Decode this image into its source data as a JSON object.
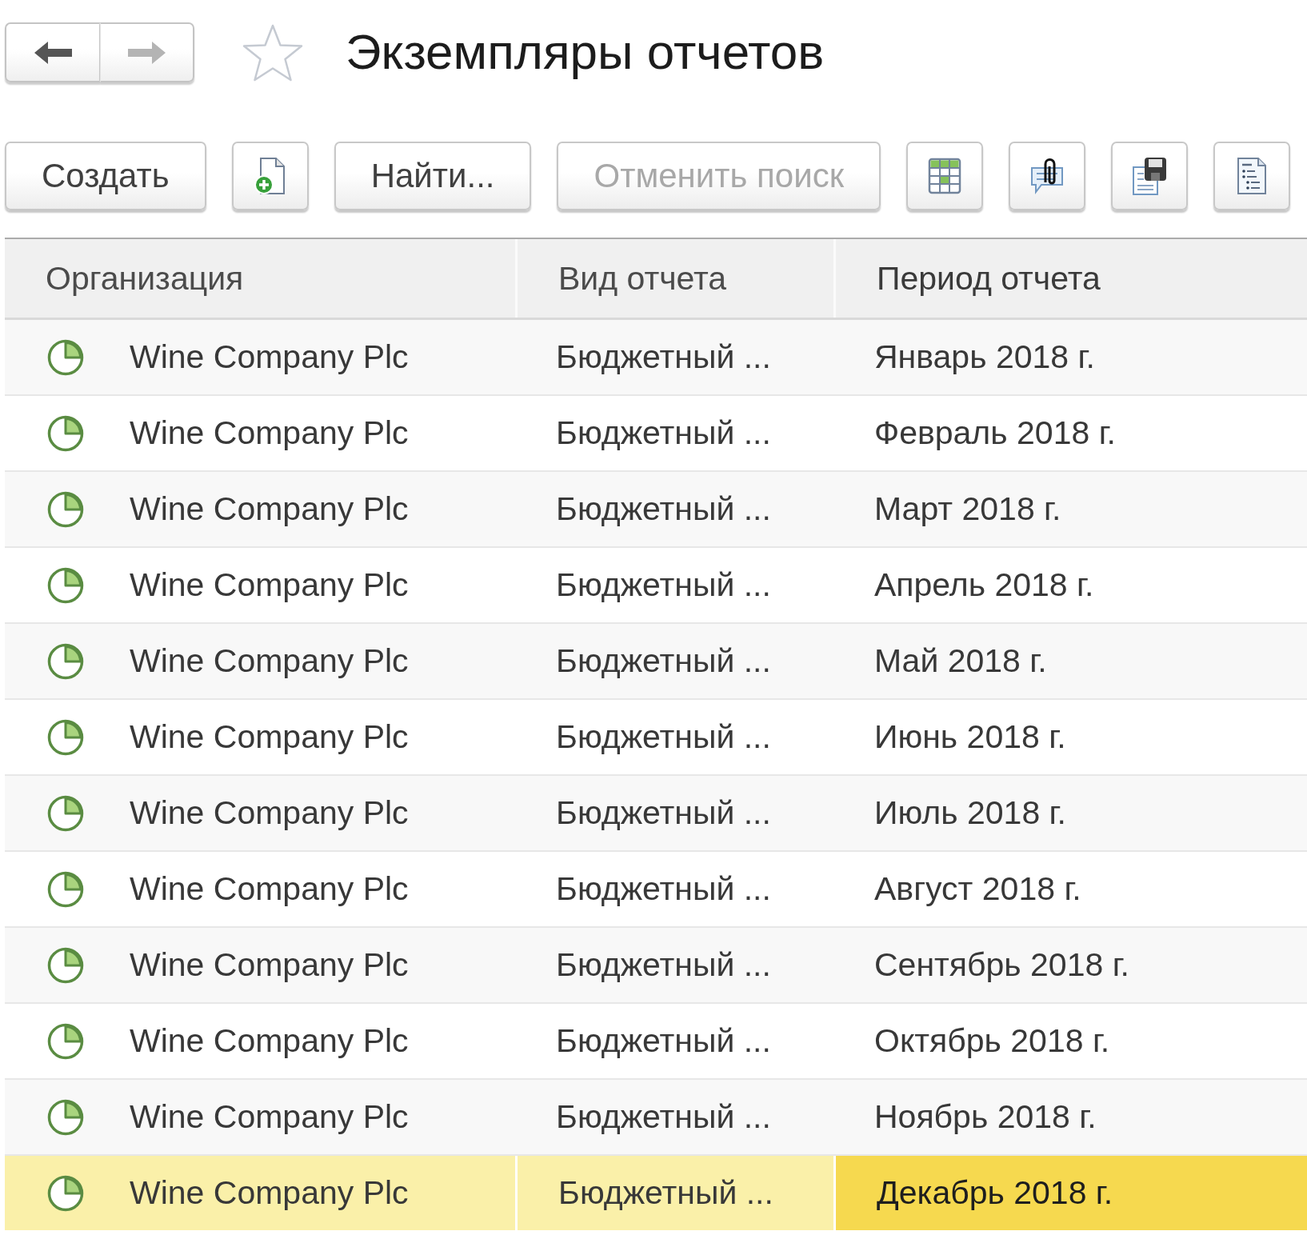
{
  "navigation": [
    {
      "kind": "back",
      "disabled": false
    },
    {
      "kind": "forward",
      "disabled": true
    }
  ],
  "favorite": false,
  "title": "Экземпляры отчетов",
  "toolbar": [
    {
      "kind": "text",
      "label": "Создать",
      "disabled": false
    },
    {
      "kind": "icon",
      "disabled": false
    },
    {
      "kind": "text",
      "label": "Найти...",
      "disabled": false
    },
    {
      "kind": "text",
      "label": "Отменить поиск",
      "disabled": true
    },
    {
      "kind": "icon",
      "disabled": false
    },
    {
      "kind": "icon",
      "disabled": false
    },
    {
      "kind": "icon",
      "disabled": false
    },
    {
      "kind": "icon",
      "disabled": false
    }
  ],
  "table": {
    "columns": [
      {
        "label": "Организация",
        "current": false
      },
      {
        "label": "Вид отчета",
        "current": false
      },
      {
        "label": "Период отчета",
        "current": true
      }
    ],
    "rows": [
      {
        "cells": [
          "Wine Company Plc",
          "Бюджетный ...",
          "Январь 2018 г."
        ],
        "selected": false
      },
      {
        "cells": [
          "Wine Company Plc",
          "Бюджетный ...",
          "Февраль 2018 г."
        ],
        "selected": false
      },
      {
        "cells": [
          "Wine Company Plc",
          "Бюджетный ...",
          "Март 2018 г."
        ],
        "selected": false
      },
      {
        "cells": [
          "Wine Company Plc",
          "Бюджетный ...",
          "Апрель 2018 г."
        ],
        "selected": false
      },
      {
        "cells": [
          "Wine Company Plc",
          "Бюджетный ...",
          "Май 2018 г."
        ],
        "selected": false
      },
      {
        "cells": [
          "Wine Company Plc",
          "Бюджетный ...",
          "Июнь 2018 г."
        ],
        "selected": false
      },
      {
        "cells": [
          "Wine Company Plc",
          "Бюджетный ...",
          "Июль 2018 г."
        ],
        "selected": false
      },
      {
        "cells": [
          "Wine Company Plc",
          "Бюджетный ...",
          "Август 2018 г."
        ],
        "selected": false
      },
      {
        "cells": [
          "Wine Company Plc",
          "Бюджетный ...",
          "Сентябрь 2018 г."
        ],
        "selected": false
      },
      {
        "cells": [
          "Wine Company Plc",
          "Бюджетный ...",
          "Октябрь 2018 г."
        ],
        "selected": false
      },
      {
        "cells": [
          "Wine Company Plc",
          "Бюджетный ...",
          "Ноябрь 2018 г."
        ],
        "selected": false
      },
      {
        "cells": [
          "Wine Company Plc",
          "Бюджетный ...",
          "Декабрь 2018 г."
        ],
        "selected": true
      }
    ]
  }
}
